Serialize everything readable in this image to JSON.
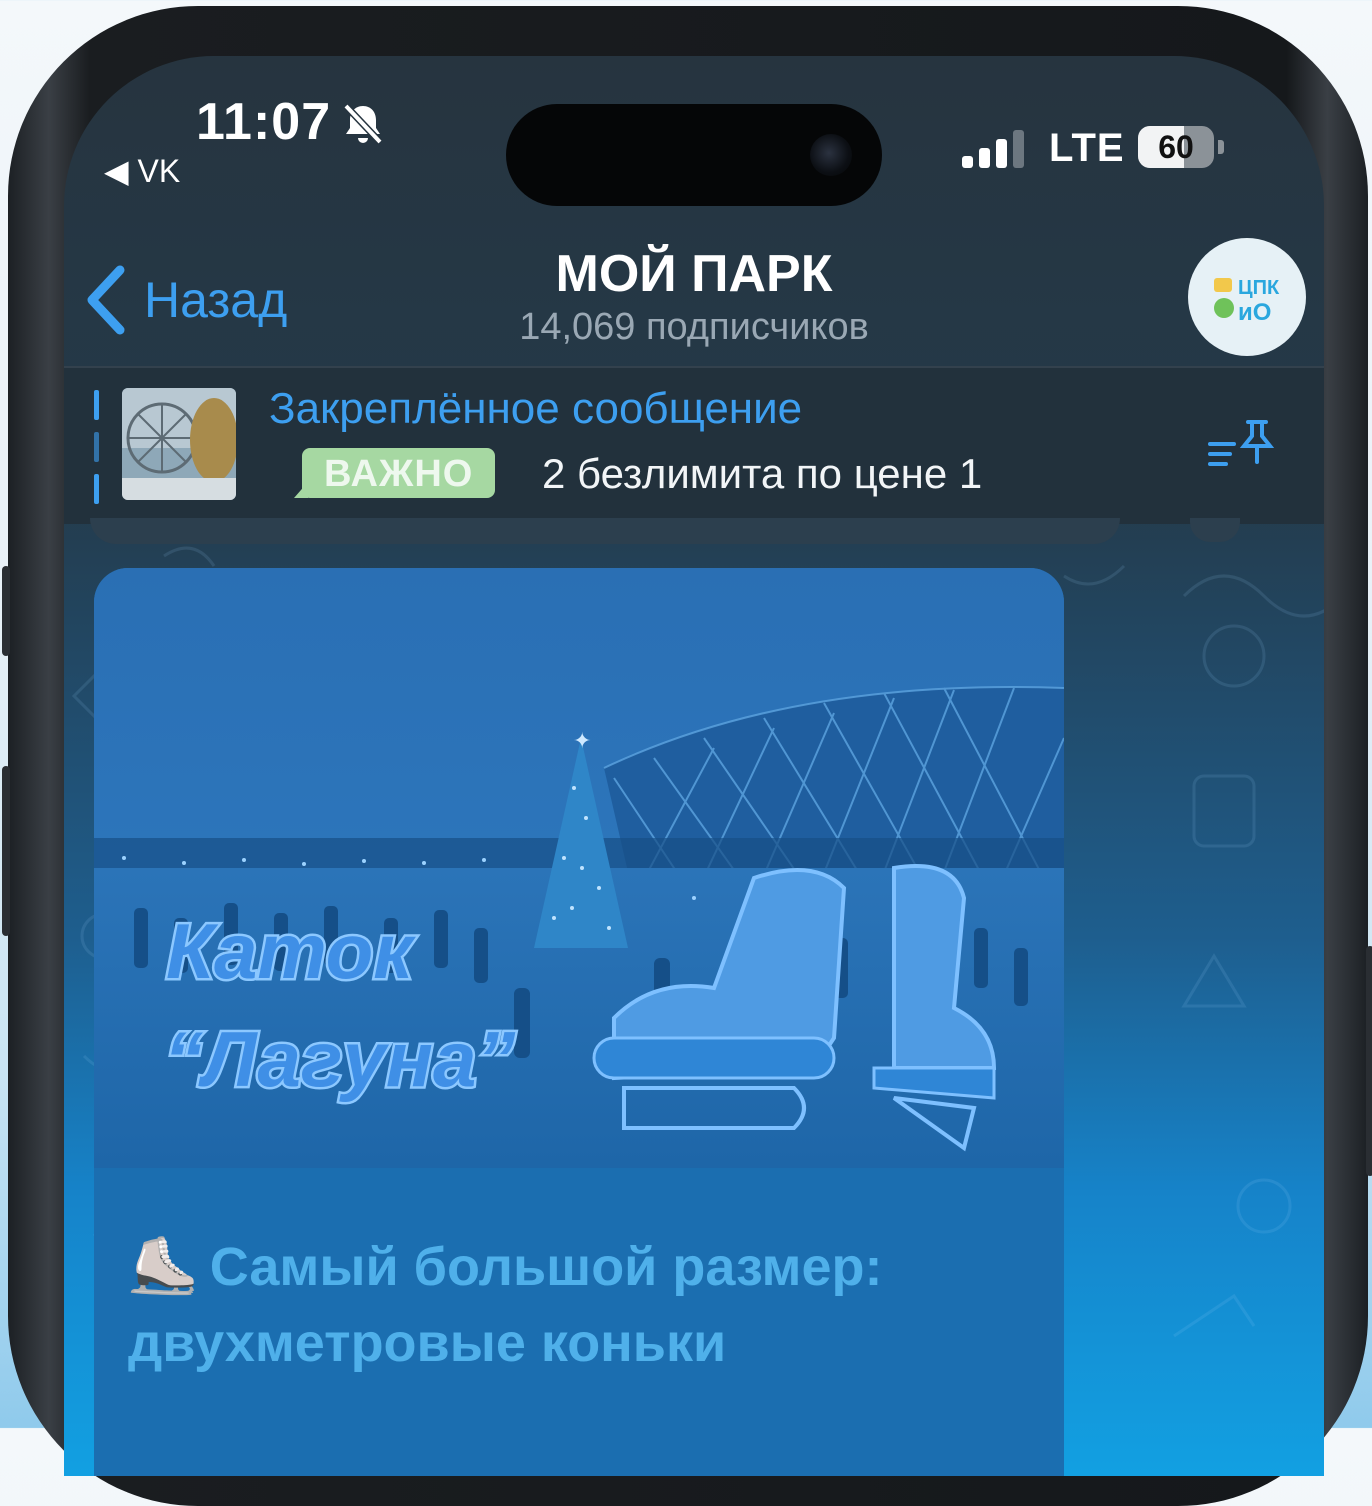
{
  "status_bar": {
    "time": "11:07",
    "back_app": "◀ VK",
    "network": "LTE",
    "battery": "60",
    "battery_level": 0.6,
    "signal_bars_active": 3,
    "silent_icon": "bell-slash-icon"
  },
  "header": {
    "back_label": "Назад",
    "title": "МОЙ ПАРК",
    "subtitle": "14,069 подписчиков",
    "avatar_lines": [
      "ЦПК",
      "иО"
    ]
  },
  "pinned": {
    "title": "Закреплённое сообщение",
    "badge": "ВАЖНО",
    "text": "2 безлимита по цене 1"
  },
  "post": {
    "image_title_line1": "Каток",
    "image_title_line2": "“Лагуна”",
    "caption_emoji": "⛸️",
    "caption_line1": "Самый большой размер:",
    "caption_line2": "двухметровые коньки"
  },
  "colors": {
    "accent": "#3d9ff0",
    "badge_green": "#a6d8a2",
    "bubble": "#1b6eb0"
  }
}
